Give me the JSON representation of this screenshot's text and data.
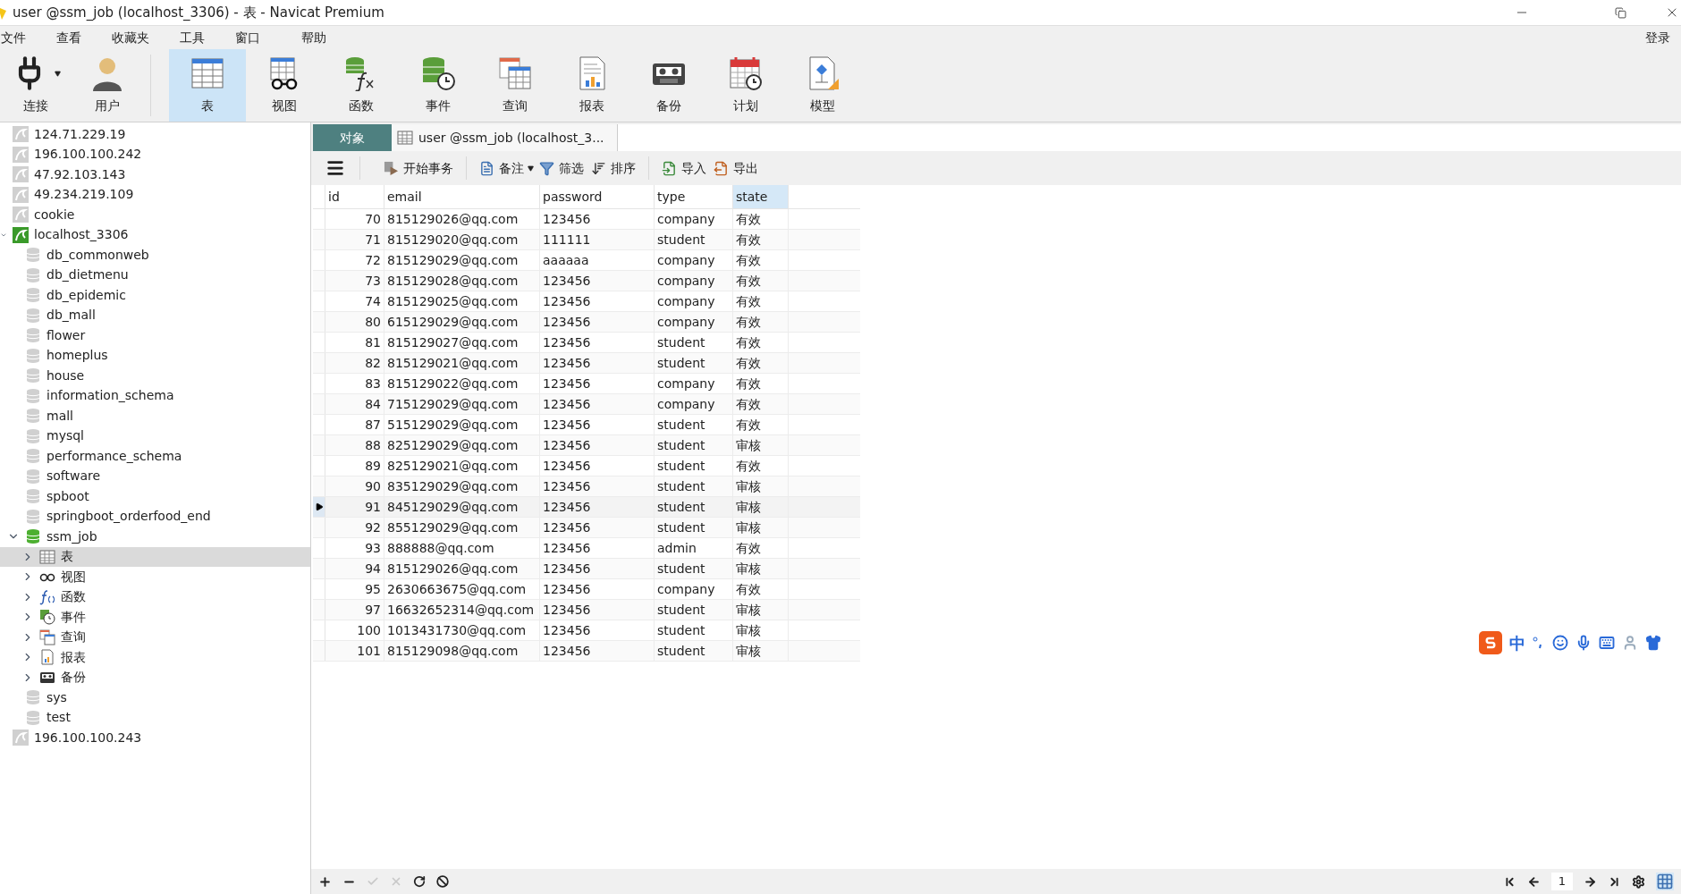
{
  "window": {
    "title": "user @ssm_job (localhost_3306) - 表 - Navicat Premium"
  },
  "menu": [
    "文件",
    "查看",
    "收藏夹",
    "工具",
    "窗口",
    "帮助"
  ],
  "login": "登录",
  "toolbar": {
    "items": [
      {
        "kind": "connect",
        "label": "连接",
        "selected": false
      },
      {
        "kind": "user",
        "label": "用户",
        "selected": false
      },
      {
        "kind": "tables",
        "label": "表",
        "selected": true
      },
      {
        "kind": "views",
        "label": "视图",
        "selected": false
      },
      {
        "kind": "functions",
        "label": "函数",
        "selected": false
      },
      {
        "kind": "events",
        "label": "事件",
        "selected": false
      },
      {
        "kind": "queries",
        "label": "查询",
        "selected": false
      },
      {
        "kind": "reports",
        "label": "报表",
        "selected": false
      },
      {
        "kind": "backups",
        "label": "备份",
        "selected": false
      },
      {
        "kind": "schedule",
        "label": "计划",
        "selected": false
      },
      {
        "kind": "model",
        "label": "模型",
        "selected": false
      }
    ]
  },
  "sidebar": {
    "tree": [
      {
        "kind": "connection",
        "label": "124.71.229.19",
        "connected": false
      },
      {
        "kind": "connection",
        "label": "196.100.100.242",
        "connected": false
      },
      {
        "kind": "connection",
        "label": "47.92.103.143",
        "connected": false
      },
      {
        "kind": "connection",
        "label": "49.234.219.109",
        "connected": false
      },
      {
        "kind": "connection",
        "label": "cookie",
        "connected": false
      },
      {
        "kind": "connection",
        "label": "localhost_3306",
        "connected": true,
        "expanded": true,
        "children": [
          {
            "kind": "database",
            "label": "db_commonweb",
            "open": false
          },
          {
            "kind": "database",
            "label": "db_dietmenu",
            "open": false
          },
          {
            "kind": "database",
            "label": "db_epidemic",
            "open": false
          },
          {
            "kind": "database",
            "label": "db_mall",
            "open": false
          },
          {
            "kind": "database",
            "label": "flower",
            "open": false
          },
          {
            "kind": "database",
            "label": "homeplus",
            "open": false
          },
          {
            "kind": "database",
            "label": "house",
            "open": false
          },
          {
            "kind": "database",
            "label": "information_schema",
            "open": false
          },
          {
            "kind": "database",
            "label": "mall",
            "open": false
          },
          {
            "kind": "database",
            "label": "mysql",
            "open": false
          },
          {
            "kind": "database",
            "label": "performance_schema",
            "open": false
          },
          {
            "kind": "database",
            "label": "software",
            "open": false
          },
          {
            "kind": "database",
            "label": "spboot",
            "open": false
          },
          {
            "kind": "database",
            "label": "springboot_orderfood_end",
            "open": false
          },
          {
            "kind": "database",
            "label": "ssm_job",
            "open": true,
            "expanded": true,
            "children": [
              {
                "kind": "tables",
                "label": "表",
                "expanded": false,
                "selected": true
              },
              {
                "kind": "views",
                "label": "视图",
                "expanded": false,
                "selected": false
              },
              {
                "kind": "functions",
                "label": "函数",
                "expanded": false,
                "selected": false
              },
              {
                "kind": "events",
                "label": "事件",
                "expanded": false,
                "selected": false
              },
              {
                "kind": "queries",
                "label": "查询",
                "expanded": false,
                "selected": false
              },
              {
                "kind": "reports",
                "label": "报表",
                "expanded": false,
                "selected": false
              },
              {
                "kind": "backups",
                "label": "备份",
                "expanded": false,
                "selected": false
              }
            ]
          },
          {
            "kind": "database",
            "label": "sys",
            "open": false
          },
          {
            "kind": "database",
            "label": "test",
            "open": false
          }
        ]
      },
      {
        "kind": "connection",
        "label": "196.100.100.243",
        "connected": false
      }
    ]
  },
  "tabs": [
    {
      "label": "对象",
      "selected": true
    },
    {
      "label": "user @ssm_job (localhost_3...",
      "selected": false
    }
  ],
  "table_toolbar": [
    {
      "kind": "transaction",
      "label": "开始事务"
    },
    {
      "kind": "note",
      "label": "备注"
    },
    {
      "kind": "filter",
      "label": "筛选"
    },
    {
      "kind": "sort",
      "label": "排序"
    },
    {
      "kind": "import",
      "label": "导入"
    },
    {
      "kind": "export",
      "label": "导出"
    }
  ],
  "table": {
    "columns": [
      {
        "label": "id",
        "selected": false
      },
      {
        "label": "email",
        "selected": false
      },
      {
        "label": "password",
        "selected": false
      },
      {
        "label": "type",
        "selected": false
      },
      {
        "label": "state",
        "selected": true
      }
    ],
    "rows": [
      {
        "cells": [
          "70",
          "815129026@qq.com",
          "123456",
          "company",
          "有效"
        ],
        "selected": false
      },
      {
        "cells": [
          "71",
          "815129020@qq.com",
          "111111",
          "student",
          "有效"
        ],
        "selected": false
      },
      {
        "cells": [
          "72",
          "815129029@qq.com",
          "aaaaaa",
          "company",
          "有效"
        ],
        "selected": false
      },
      {
        "cells": [
          "73",
          "815129028@qq.com",
          "123456",
          "company",
          "有效"
        ],
        "selected": false
      },
      {
        "cells": [
          "74",
          "815129025@qq.com",
          "123456",
          "company",
          "有效"
        ],
        "selected": false
      },
      {
        "cells": [
          "80",
          "615129029@qq.com",
          "123456",
          "company",
          "有效"
        ],
        "selected": false
      },
      {
        "cells": [
          "81",
          "815129027@qq.com",
          "123456",
          "student",
          "有效"
        ],
        "selected": false
      },
      {
        "cells": [
          "82",
          "815129021@qq.com",
          "123456",
          "student",
          "有效"
        ],
        "selected": false
      },
      {
        "cells": [
          "83",
          "815129022@qq.com",
          "123456",
          "company",
          "有效"
        ],
        "selected": false
      },
      {
        "cells": [
          "84",
          "715129029@qq.com",
          "123456",
          "company",
          "有效"
        ],
        "selected": false
      },
      {
        "cells": [
          "87",
          "515129029@qq.com",
          "123456",
          "student",
          "有效"
        ],
        "selected": false
      },
      {
        "cells": [
          "88",
          "825129029@qq.com",
          "123456",
          "student",
          "审核"
        ],
        "selected": false
      },
      {
        "cells": [
          "89",
          "825129021@qq.com",
          "123456",
          "student",
          "有效"
        ],
        "selected": false
      },
      {
        "cells": [
          "90",
          "835129029@qq.com",
          "123456",
          "student",
          "审核"
        ],
        "selected": false
      },
      {
        "cells": [
          "91",
          "845129029@qq.com",
          "123456",
          "student",
          "审核"
        ],
        "selected": true
      },
      {
        "cells": [
          "92",
          "855129029@qq.com",
          "123456",
          "student",
          "审核"
        ],
        "selected": false
      },
      {
        "cells": [
          "93",
          "888888@qq.com",
          "123456",
          "admin",
          "有效"
        ],
        "selected": false
      },
      {
        "cells": [
          "94",
          "815129026@qq.com",
          "123456",
          "student",
          "审核"
        ],
        "selected": false
      },
      {
        "cells": [
          "95",
          "2630663675@qq.com",
          "123456",
          "company",
          "有效"
        ],
        "selected": false
      },
      {
        "cells": [
          "97",
          "16632652314@qq.com",
          "123456",
          "student",
          "审核"
        ],
        "selected": false
      },
      {
        "cells": [
          "100",
          "1013431730@qq.com",
          "123456",
          "student",
          "审核"
        ],
        "selected": false
      },
      {
        "cells": [
          "101",
          "815129098@qq.com",
          "123456",
          "student",
          "审核"
        ],
        "selected": false
      }
    ]
  },
  "pagination": {
    "page": "1"
  },
  "ime": {
    "mode": "中"
  }
}
